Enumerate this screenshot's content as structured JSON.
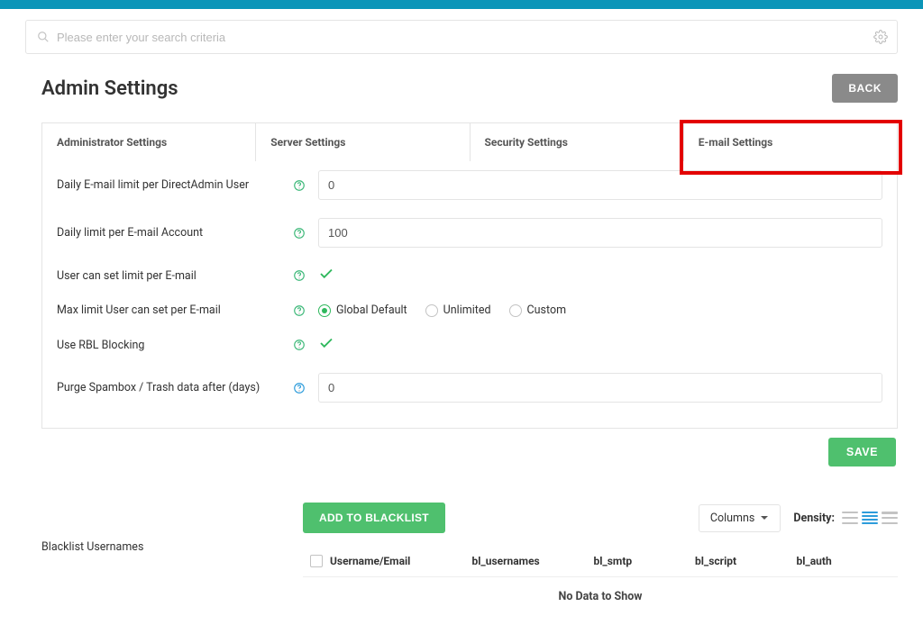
{
  "search": {
    "placeholder": "Please enter your search criteria"
  },
  "header": {
    "title": "Admin Settings",
    "back_label": "BACK"
  },
  "tabs": {
    "items": [
      {
        "label": "Administrator Settings"
      },
      {
        "label": "Server Settings"
      },
      {
        "label": "Security Settings"
      },
      {
        "label": "E-mail Settings"
      }
    ],
    "active_index": 3
  },
  "form": {
    "daily_limit_user": {
      "label": "Daily E-mail limit per DirectAdmin User",
      "value": "0"
    },
    "daily_limit_account": {
      "label": "Daily limit per E-mail Account",
      "value": "100"
    },
    "user_can_set": {
      "label": "User can set limit per E-mail",
      "checked": true
    },
    "max_limit": {
      "label": "Max limit User can set per E-mail",
      "options": [
        {
          "label": "Global Default",
          "selected": true
        },
        {
          "label": "Unlimited",
          "selected": false
        },
        {
          "label": "Custom",
          "selected": false
        }
      ]
    },
    "use_rbl": {
      "label": "Use RBL Blocking",
      "checked": true
    },
    "purge": {
      "label": "Purge Spambox / Trash data after (days)",
      "value": "0"
    },
    "save_label": "SAVE"
  },
  "blacklist": {
    "section_label": "Blacklist Usernames",
    "add_label": "ADD TO BLACKLIST",
    "columns_label": "Columns",
    "density_label": "Density:",
    "headers": {
      "c1": "Username/Email",
      "c2": "bl_usernames",
      "c3": "bl_smtp",
      "c4": "bl_script",
      "c5": "bl_auth"
    },
    "empty_text": "No Data to Show"
  }
}
